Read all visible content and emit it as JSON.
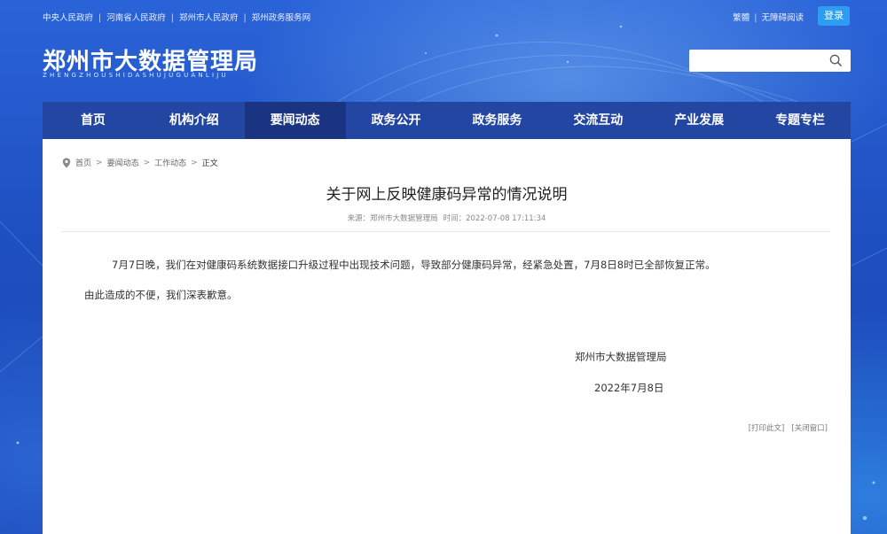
{
  "topbar": {
    "links": [
      "中央人民政府",
      "河南省人民政府",
      "郑州市人民政府",
      "郑州政务服务网"
    ],
    "right_links": [
      "繁體",
      "无障碍阅读"
    ],
    "login_label": "登录"
  },
  "header": {
    "title": "郑州市大数据管理局",
    "subtitle": "ZHENGZHOUSHIDASHUJUGUANLIJU",
    "search_placeholder": ""
  },
  "nav": {
    "items": [
      {
        "label": "首页"
      },
      {
        "label": "机构介绍"
      },
      {
        "label": "要闻动态",
        "active": true
      },
      {
        "label": "政务公开"
      },
      {
        "label": "政务服务"
      },
      {
        "label": "交流互动"
      },
      {
        "label": "产业发展"
      },
      {
        "label": "专题专栏"
      }
    ]
  },
  "breadcrumb": {
    "items": [
      "首页",
      "要闻动态",
      "工作动态"
    ],
    "current": "正文"
  },
  "article": {
    "title": "关于网上反映健康码异常的情况说明",
    "source": "来源：郑州市大数据管理局",
    "time": "时间：2022-07-08 17:11:34",
    "paragraph1": "7月7日晚，我们在对健康码系统数据接口升级过程中出现技术问题，导致部分健康码异常，经紧急处置，7月8日8时已全部恢复正常。",
    "paragraph2": "由此造成的不便，我们深表歉意。",
    "signature_org": "郑州市大数据管理局",
    "signature_date": "2022年7月8日",
    "print_label": "[打印此文]",
    "close_label": "[关闭窗口]"
  },
  "colors": {
    "nav_bg": "#2346a3",
    "nav_active": "#1a3482",
    "login_btn": "#2c9df3"
  }
}
